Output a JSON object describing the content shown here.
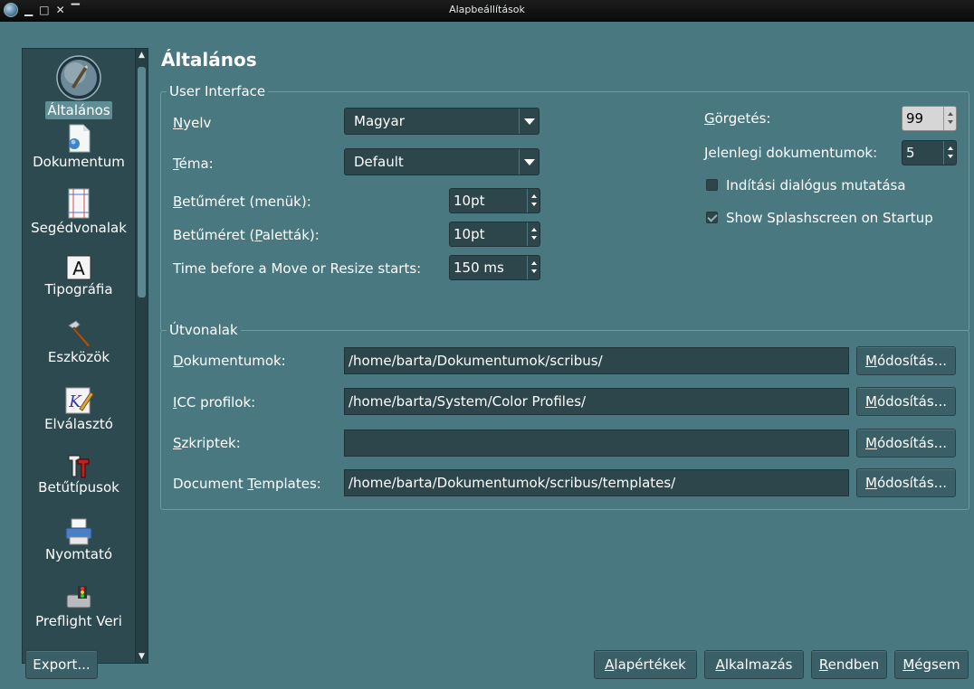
{
  "window": {
    "title": "Alapbeállítások"
  },
  "sidebar": {
    "items": [
      {
        "label": "Általános",
        "icon": "general-icon",
        "active": true
      },
      {
        "label": "Dokumentum",
        "icon": "document-icon"
      },
      {
        "label": "Segédvonalak",
        "icon": "guides-icon"
      },
      {
        "label": "Tipográfia",
        "icon": "typography-icon"
      },
      {
        "label": "Eszközök",
        "icon": "tools-icon"
      },
      {
        "label": "Elválasztó",
        "icon": "hyphenator-icon"
      },
      {
        "label": "Betűtípusok",
        "icon": "fonts-icon"
      },
      {
        "label": "Nyomtató",
        "icon": "printer-icon"
      },
      {
        "label": "Preflight Veri",
        "icon": "preflight-icon"
      }
    ]
  },
  "main": {
    "heading": "Általános",
    "ui_group": {
      "legend": "User Interface",
      "language": {
        "label_first": "N",
        "label_rest": "yelv",
        "value": "Magyar"
      },
      "theme": {
        "label_first": "T",
        "label_rest": "éma:",
        "value": "Default"
      },
      "font_menus": {
        "label_first": "B",
        "label_rest": "etűméret (menük):",
        "value": "10pt"
      },
      "font_palettes": {
        "label_pre": "Betűméret (",
        "label_u": "P",
        "label_post": "aletták):",
        "value": "10pt"
      },
      "move_resize": {
        "label": "Time before a Move or Resize starts:",
        "value": "150 ms"
      },
      "scroll": {
        "label_first": "G",
        "label_rest": "örgetés:",
        "value": "99"
      },
      "recent_docs": {
        "label_first": "J",
        "label_rest": "elenlegi dokumentumok:",
        "value": "5"
      },
      "show_startup": {
        "label": "Indítási dialógus mutatása",
        "checked": false
      },
      "show_splash": {
        "label": "Show Splashscreen on Startup",
        "checked": true
      }
    },
    "paths_group": {
      "legend": "Útvonalak",
      "rows": [
        {
          "label_pre": "",
          "label_u": "D",
          "label_post": "okumentumok:",
          "value": "/home/barta/Dokumentumok/scribus/",
          "button": "Módosítás..."
        },
        {
          "label_pre": "",
          "label_u": "I",
          "label_post": "CC profilok:",
          "value": "/home/barta/System/Color Profiles/",
          "button": "Módosítás..."
        },
        {
          "label_pre": "",
          "label_u": "S",
          "label_post": "zkriptek:",
          "value": "",
          "button": "Módosítás..."
        },
        {
          "label_pre": "Document ",
          "label_u": "T",
          "label_post": "emplates:",
          "value": "/home/barta/Dokumentumok/scribus/templates/",
          "button": "Módosítás..."
        }
      ]
    }
  },
  "footer": {
    "export": "Export...",
    "defaults_first": "A",
    "defaults_rest": "lapértékek",
    "apply_first": "A",
    "apply_rest": "lkalmazás",
    "ok_first": "R",
    "ok_rest": "endben",
    "cancel_first": "M",
    "cancel_rest": "égsem"
  },
  "colors": {
    "background": "#4a7880",
    "field": "#2c464c",
    "sidebar": "#2d4a51"
  }
}
